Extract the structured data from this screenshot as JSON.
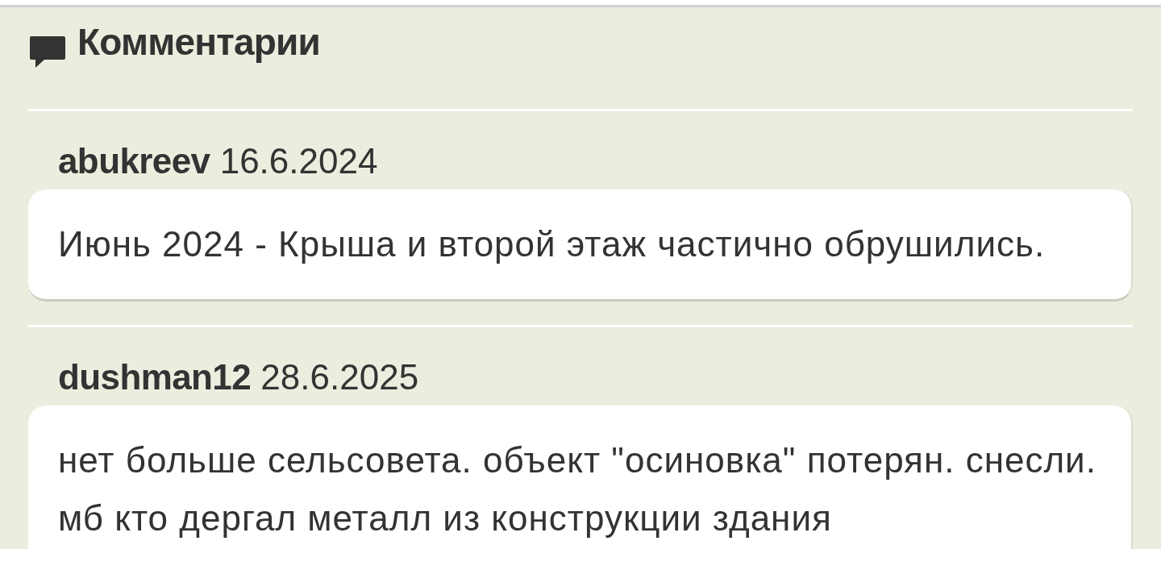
{
  "section": {
    "title": "Комментарии"
  },
  "comments": [
    {
      "author": "abukreev",
      "date": "16.6.2024",
      "text": "Июнь 2024 - Крыша и второй этаж частично обрушились."
    },
    {
      "author": "dushman12",
      "date": "28.6.2025",
      "text": "нет больше сельсовета. объект \"осиновка\" потерян. снесли. мб кто дергал металл из конструкции здания"
    }
  ]
}
